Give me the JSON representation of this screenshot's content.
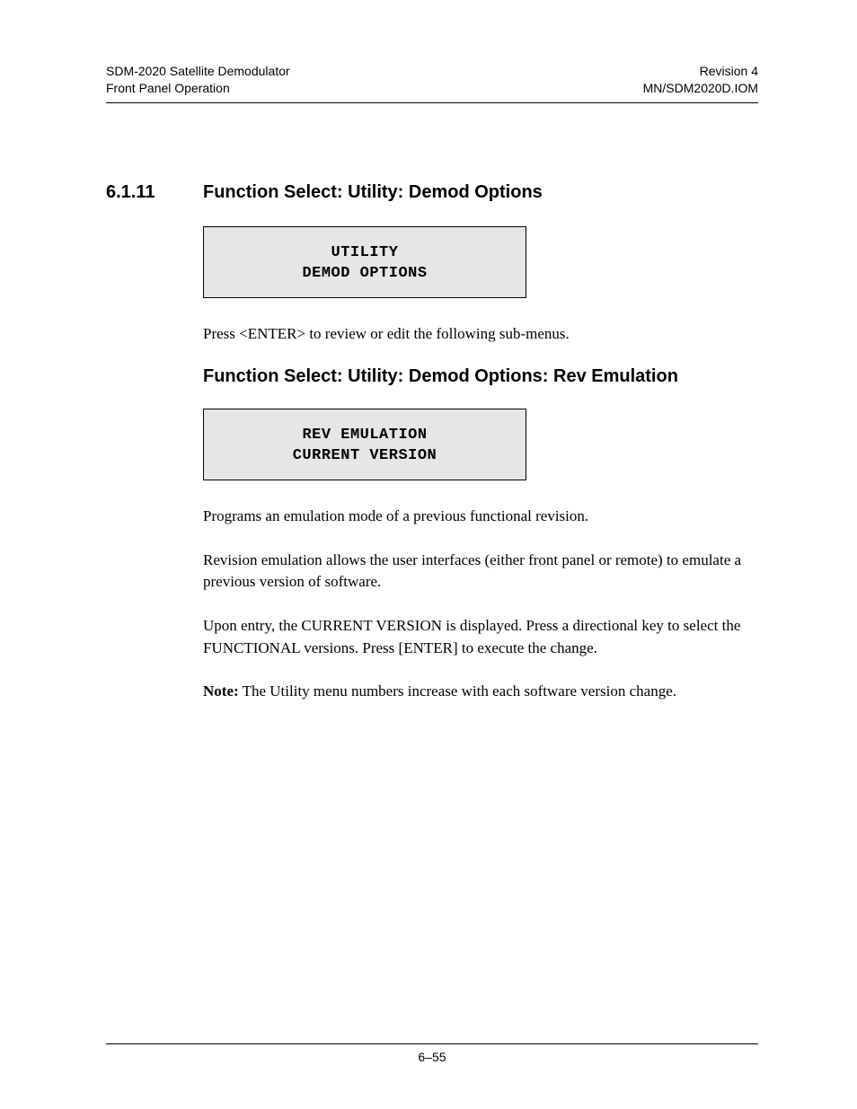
{
  "header": {
    "left_line1": "SDM-2020 Satellite Demodulator",
    "left_line2": "Front Panel Operation",
    "right_line1": "Revision 4",
    "right_line2": "MN/SDM2020D.IOM"
  },
  "section": {
    "number": "6.1.11",
    "title": "Function Select: Utility: Demod Options",
    "lcd1_line1": "UTILITY",
    "lcd1_line2": "DEMOD OPTIONS",
    "para1": "Press <ENTER> to review or edit the following sub-menus.",
    "sub_title": "Function Select: Utility: Demod Options: Rev Emulation",
    "lcd2_line1": "REV EMULATION",
    "lcd2_line2": "CURRENT VERSION",
    "para2": "Programs an emulation mode of a previous functional revision.",
    "para3": "Revision emulation allows the user interfaces (either front panel or remote) to emulate a previous version of software.",
    "para4": "Upon entry, the CURRENT VERSION is displayed. Press a directional key to select the FUNCTIONAL versions. Press [ENTER] to execute the change.",
    "note_label": "Note:",
    "note_text": " The Utility menu numbers increase with each software version change."
  },
  "footer": {
    "page_label": "6–55"
  }
}
